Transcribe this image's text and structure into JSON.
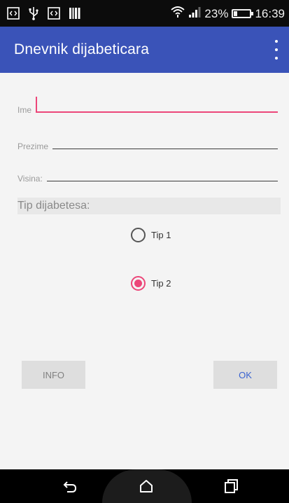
{
  "statusbar": {
    "left_icons": [
      "code-notification-icon",
      "usb-icon",
      "code-notification-icon",
      "barcode-icon"
    ],
    "battery_percent": "23%",
    "battery_level": 0.23,
    "time": "16:39"
  },
  "appbar": {
    "title": "Dnevnik dijabeticara",
    "menu_icon": "overflow-menu-icon"
  },
  "form": {
    "ime": {
      "label": "Ime",
      "value": "",
      "focused": true
    },
    "prezime": {
      "label": "Prezime",
      "value": ""
    },
    "visina": {
      "label": "Visina:",
      "value": ""
    },
    "section_label": "Tip dijabetesa:",
    "radio_options": [
      {
        "label": "Tip 1",
        "checked": false
      },
      {
        "label": "Tip 2",
        "checked": true
      }
    ]
  },
  "buttons": {
    "info": "INFO",
    "ok": "OK"
  },
  "navbar": {
    "icons": [
      "back-icon",
      "home-icon",
      "recents-icon"
    ]
  },
  "colors": {
    "primary": "#3a53b8",
    "accent": "#ec4679",
    "ok_text": "#3a63d0"
  }
}
